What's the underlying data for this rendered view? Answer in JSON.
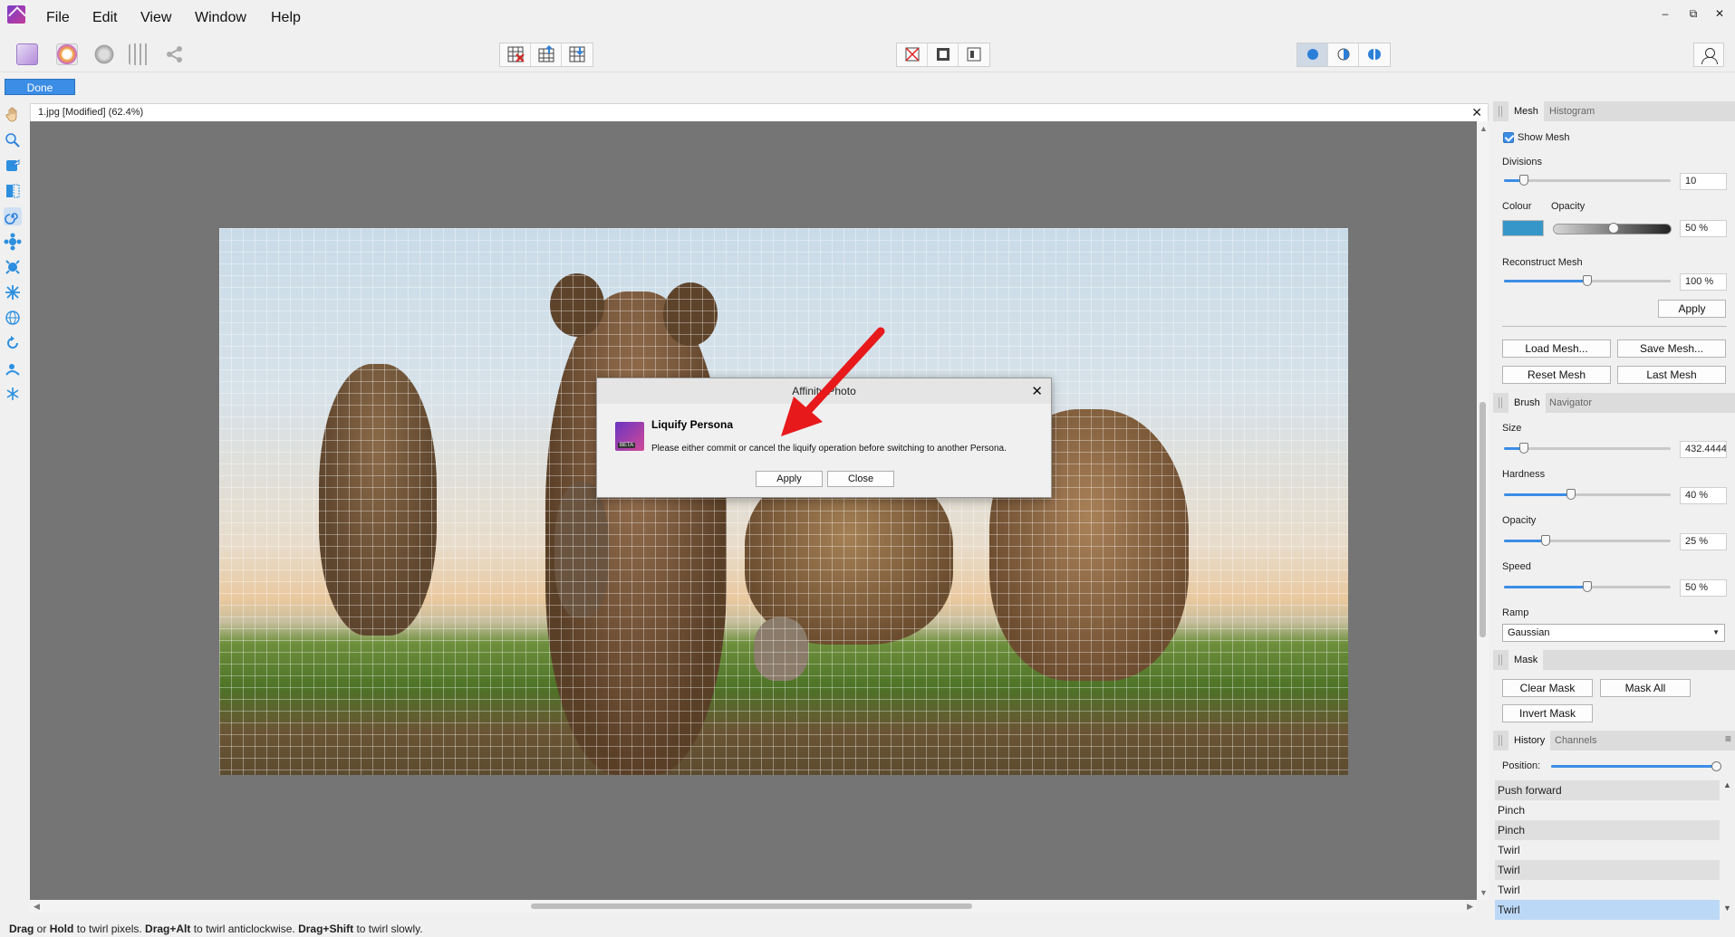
{
  "menubar": {
    "items": [
      "File",
      "Edit",
      "View",
      "Window",
      "Help"
    ],
    "window_controls": [
      "–",
      "⧉",
      "✕"
    ]
  },
  "toolbar": {
    "done_label": "Done"
  },
  "document": {
    "tab_title": "1.jpg [Modified] (62.4%)",
    "close_glyph": "✕"
  },
  "dialog": {
    "title": "Affinity Photo",
    "close_glyph": "✕",
    "logo_badge": "BETA",
    "heading": "Liquify Persona",
    "message": "Please either commit or cancel the liquify operation before switching to another Persona.",
    "apply_label": "Apply",
    "close_label": "Close"
  },
  "mesh_panel": {
    "tabs": [
      "Mesh",
      "Histogram"
    ],
    "show_mesh_label": "Show Mesh",
    "show_mesh_checked": true,
    "divisions_label": "Divisions",
    "divisions_value": "10",
    "divisions_level": 0.12,
    "colour_label": "Colour",
    "opacity_label": "Opacity",
    "opacity_value": "50 %",
    "mesh_colour": "#3796c9",
    "reconstruct_label": "Reconstruct Mesh",
    "reconstruct_value": "100 %",
    "reconstruct_level": 0.5,
    "apply_label": "Apply",
    "load_mesh_label": "Load Mesh...",
    "save_mesh_label": "Save Mesh...",
    "reset_mesh_label": "Reset Mesh",
    "last_mesh_label": "Last Mesh"
  },
  "brush_panel": {
    "tabs": [
      "Brush",
      "Navigator"
    ],
    "size_label": "Size",
    "size_value": "432.4444!",
    "size_level": 0.12,
    "hardness_label": "Hardness",
    "hardness_value": "40 %",
    "hardness_level": 0.4,
    "opacity_label": "Opacity",
    "opacity_value": "25 %",
    "opacity_level": 0.25,
    "speed_label": "Speed",
    "speed_value": "50 %",
    "speed_level": 0.5,
    "ramp_label": "Ramp",
    "ramp_value": "Gaussian"
  },
  "mask_panel": {
    "tabs": [
      "Mask"
    ],
    "clear_mask_label": "Clear Mask",
    "mask_all_label": "Mask All",
    "invert_mask_label": "Invert Mask"
  },
  "history_panel": {
    "tabs": [
      "History",
      "Channels"
    ],
    "position_label": "Position:",
    "position_level": 1.0,
    "items": [
      "Push forward",
      "Pinch",
      "Pinch",
      "Twirl",
      "Twirl",
      "Twirl",
      "Twirl"
    ]
  },
  "statusbar": {
    "parts": [
      {
        "bold": true,
        "text": "Drag"
      },
      {
        "bold": false,
        "text": " or "
      },
      {
        "bold": true,
        "text": "Hold"
      },
      {
        "bold": false,
        "text": " to twirl pixels. "
      },
      {
        "bold": true,
        "text": "Drag+Alt"
      },
      {
        "bold": false,
        "text": " to twirl anticlockwise. "
      },
      {
        "bold": true,
        "text": "Drag+Shift"
      },
      {
        "bold": false,
        "text": " to twirl slowly."
      }
    ]
  },
  "colors": {
    "accent": "#3b8de5",
    "canvas_bg": "#757575",
    "annotation_arrow": "#e8191b"
  },
  "icons": [
    "app-logo-icon",
    "hand-tool-icon",
    "zoom-tool-icon",
    "forward-warp-icon",
    "twirl-tool-icon",
    "pinch-icon",
    "punch-icon",
    "turbulence-icon",
    "user-icon"
  ]
}
